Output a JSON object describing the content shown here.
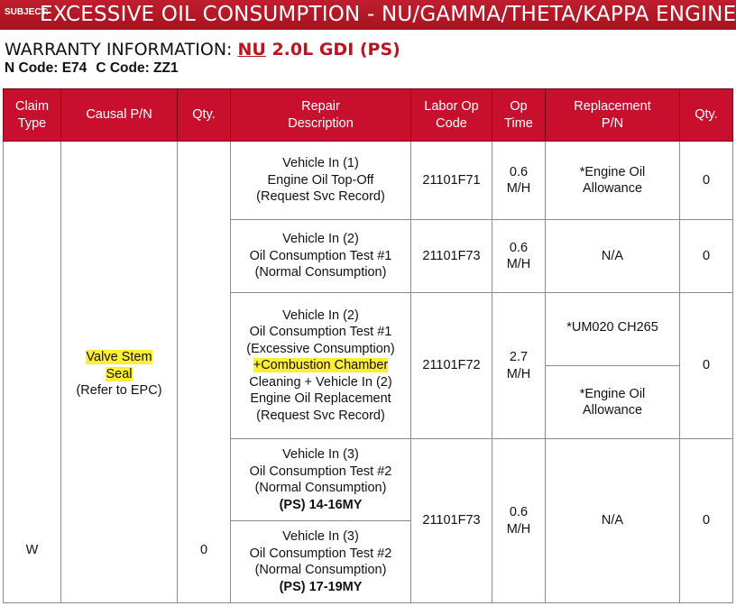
{
  "subject": {
    "tag": "SUBJECT:",
    "title": "EXCESSIVE OIL CONSUMPTION - NU/GAMMA/THETA/KAPPA ENGINES"
  },
  "warranty": {
    "label": "WARRANTY INFORMATION: ",
    "engine_code": "NU",
    "engine_desc": " 2.0L GDI (PS)",
    "n_code": "N Code: E74",
    "c_code": "C Code: ZZ1"
  },
  "colors": {
    "header_red": "#c8102e",
    "highlight": "#ffee33"
  },
  "table": {
    "headers": {
      "claim_type": [
        "Claim",
        "Type"
      ],
      "causal_pn": "Causal P/N",
      "qty": "Qty.",
      "repair_desc": [
        "Repair",
        "Description"
      ],
      "labor_op": [
        "Labor Op",
        "Code"
      ],
      "op_time": [
        "Op",
        "Time"
      ],
      "replacement_pn": [
        "Replacement",
        "P/N"
      ],
      "qty2": "Qty."
    },
    "causal": {
      "highlight_line1": "Valve Stem",
      "highlight_line2": "Seal",
      "note": "(Refer to EPC)"
    },
    "claim_type_value": "W",
    "qty_value": "0",
    "rows": [
      {
        "desc": [
          "Vehicle In (1)",
          "Engine Oil Top-Off",
          "(Request Svc Record)"
        ],
        "labor": "21101F71",
        "time": [
          "0.6",
          "M/H"
        ],
        "replacement": [
          "*Engine Oil",
          "Allowance"
        ],
        "qty": "0"
      },
      {
        "desc": [
          "Vehicle In (2)",
          "Oil Consumption Test #1",
          "(Normal Consumption)"
        ],
        "labor": "21101F73",
        "time": [
          "0.6",
          "M/H"
        ],
        "replacement": [
          "N/A"
        ],
        "qty": "0"
      },
      {
        "desc": [
          "Vehicle In (2)",
          "Oil Consumption Test #1",
          "(Excessive Consumption)",
          "+Combustion Chamber",
          "Cleaning + Vehicle In (2)",
          "Engine Oil Replacement",
          "(Request Svc Record)"
        ],
        "labor": "21101F72",
        "time": [
          "2.7",
          "M/H"
        ],
        "replacement_a": [
          "*UM020 CH265"
        ],
        "replacement_b": [
          "*Engine Oil",
          "Allowance"
        ],
        "qty": "0"
      },
      {
        "desc_a": [
          "Vehicle In (3)",
          "Oil Consumption Test #2",
          "(Normal Consumption)",
          "(PS) 14-16MY"
        ],
        "desc_b": [
          "Vehicle In (3)",
          "Oil Consumption Test #2",
          "(Normal Consumption)",
          "(PS) 17-19MY"
        ],
        "labor": "21101F73",
        "time": [
          "0.6",
          "M/H"
        ],
        "replacement": [
          "N/A"
        ],
        "qty": "0"
      }
    ]
  }
}
